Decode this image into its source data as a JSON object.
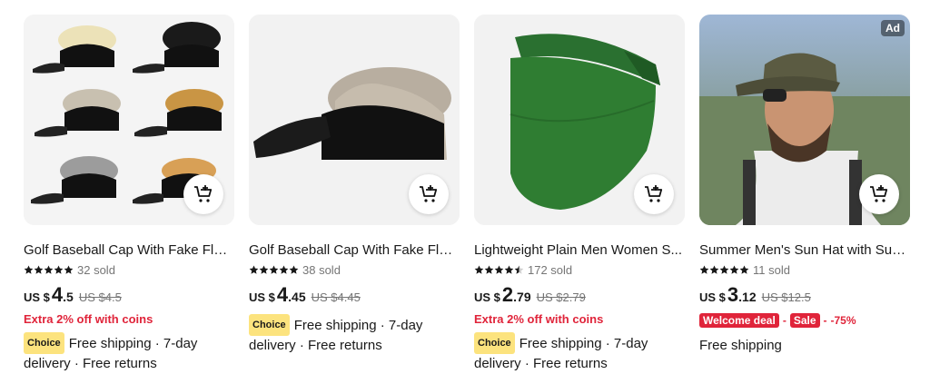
{
  "products": [
    {
      "title": "Golf Baseball Cap With Fake Flair...",
      "sold": "32 sold",
      "currency": "US $",
      "price_int": "4",
      "price_dec": ".5",
      "original": "US $4.5",
      "extra": "Extra 2% off with coins",
      "choice_label": "Choice",
      "shipping": "Free shipping · 7-day delivery · Free returns",
      "rating": 5,
      "image_dots": 7,
      "active_dot": 1
    },
    {
      "title": "Golf Baseball Cap With Fake Flair...",
      "sold": "38 sold",
      "currency": "US $",
      "price_int": "4",
      "price_dec": ".45",
      "original": "US $4.45",
      "choice_label": "Choice",
      "shipping": "Free shipping · 7-day delivery · Free returns",
      "rating": 5,
      "image_dots": 7,
      "active_dot": 1
    },
    {
      "title": "Lightweight Plain Men Women S...",
      "sold": "172 sold",
      "currency": "US $",
      "price_int": "2",
      "price_dec": ".79",
      "original": "US $2.79",
      "extra": "Extra 2% off with coins",
      "choice_label": "Choice",
      "shipping": "Free shipping · 7-day delivery · Free returns",
      "rating": 4.5,
      "image_dots": 7,
      "active_dot": 1
    },
    {
      "title": "Summer Men's Sun Hat with Sun...",
      "sold": "11 sold",
      "currency": "US $",
      "price_int": "3",
      "price_dec": ".12",
      "original": "US $12.5",
      "promo_welcome": "Welcome deal",
      "promo_sale": "Sale",
      "promo_discount": "-75%",
      "ad_label": "Ad",
      "shipping": "Free shipping",
      "rating": 5,
      "image_dots": 7,
      "active_dot": 1
    }
  ],
  "icons": {
    "cart": "add-to-cart-icon",
    "star": "star-icon"
  },
  "colors": {
    "accent": "#e0243a",
    "choice": "#fce37e",
    "visor_green": "#2f7d32"
  }
}
